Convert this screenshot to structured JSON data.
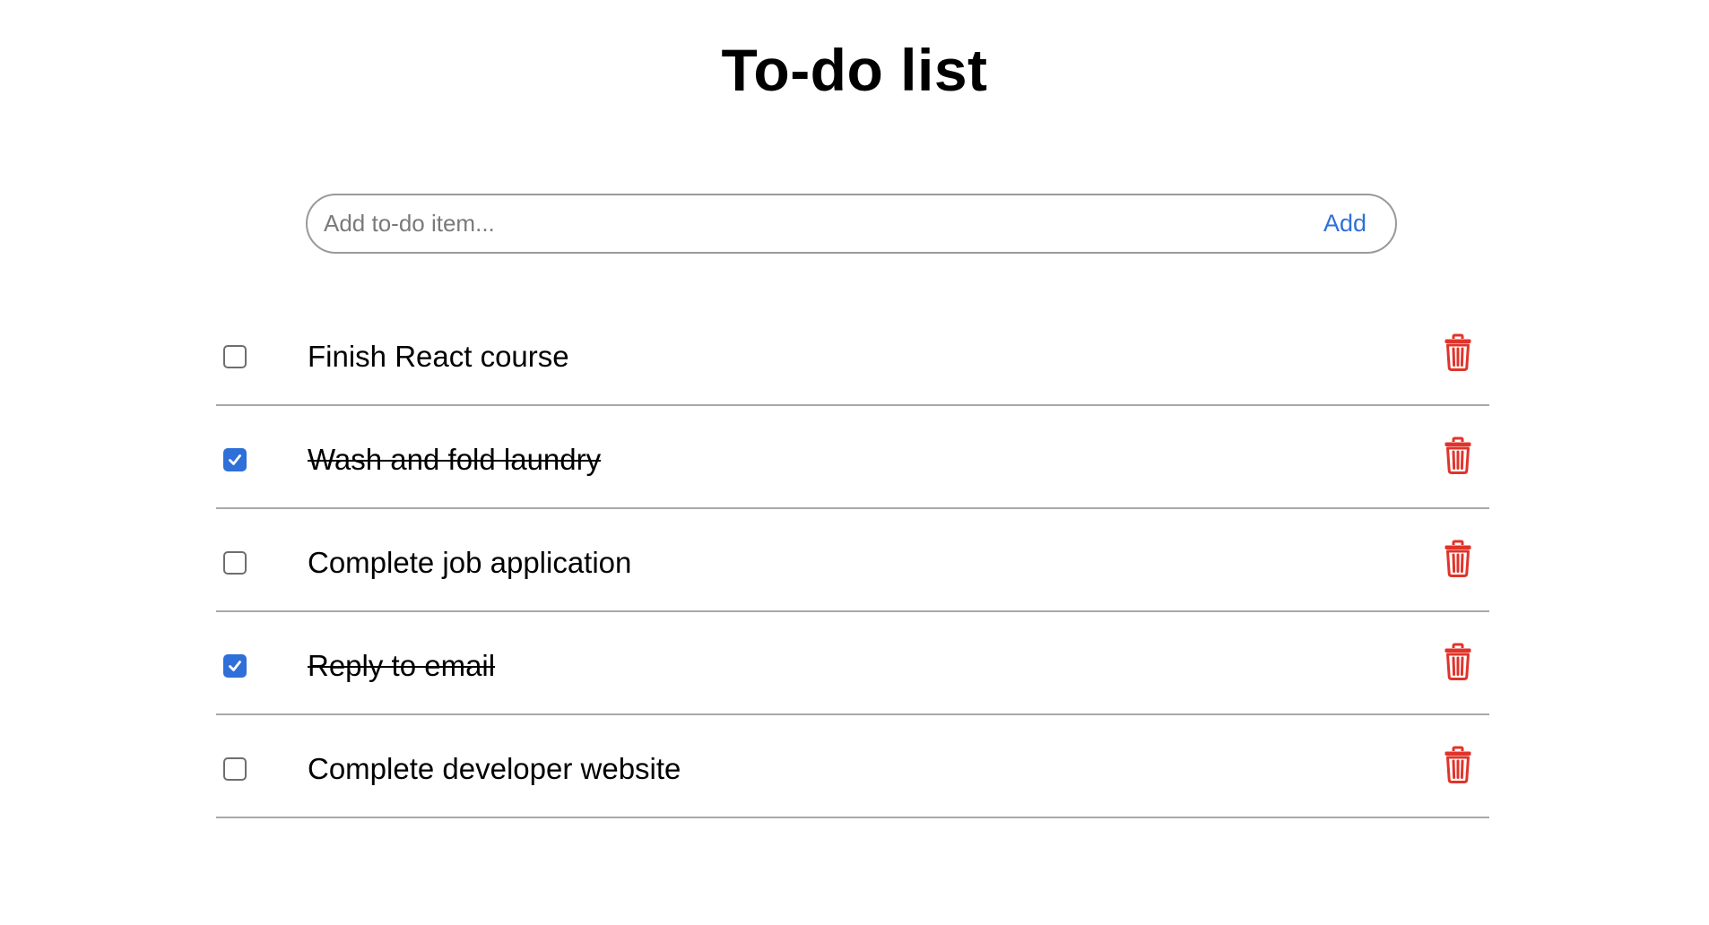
{
  "page": {
    "title": "To-do list"
  },
  "add_form": {
    "placeholder": "Add to-do item...",
    "value": "",
    "add_label": "Add"
  },
  "todos": [
    {
      "text": "Finish React course",
      "completed": false
    },
    {
      "text": "Wash and fold laundry",
      "completed": true
    },
    {
      "text": "Complete job application",
      "completed": false
    },
    {
      "text": "Reply to email",
      "completed": true
    },
    {
      "text": "Complete developer website",
      "completed": false
    }
  ],
  "icons": {
    "delete": "trash-icon",
    "check": "checkmark-icon"
  },
  "colors": {
    "accent": "#2f6fd9",
    "delete": "#e0342b",
    "divider": "#a8a8a8",
    "input_border": "#9a9a9a"
  }
}
